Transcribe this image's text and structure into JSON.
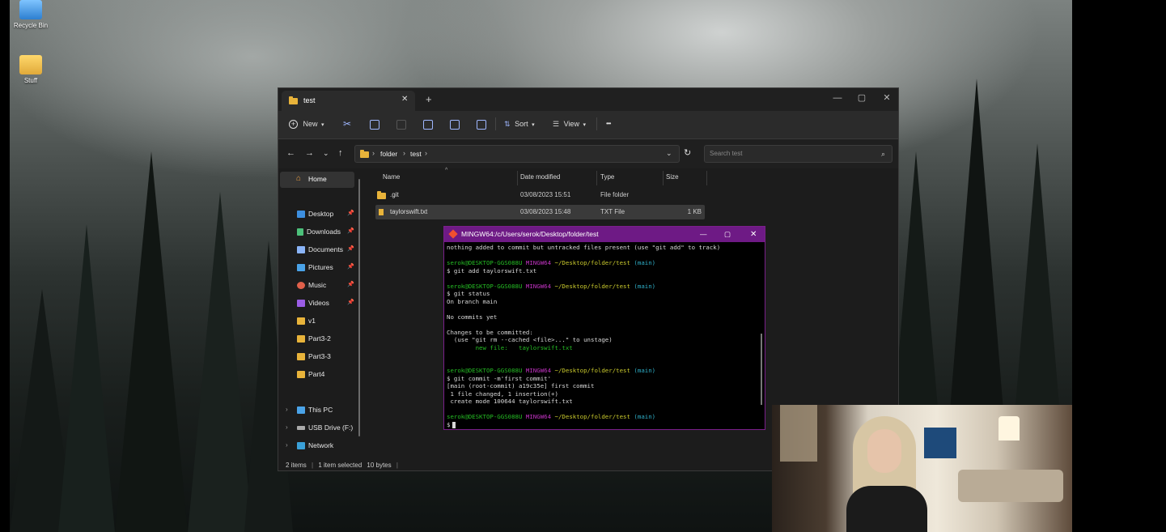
{
  "desktop": {
    "icons": [
      {
        "label": "Recycle Bin",
        "icon": "recycle-bin-icon"
      },
      {
        "label": "Stuff",
        "icon": "folder-icon"
      }
    ]
  },
  "explorer": {
    "tab_title": "test",
    "new_tab": "+",
    "window_buttons": {
      "minimize": "—",
      "maximize": "▢",
      "close": "✕"
    },
    "toolbar": {
      "new_label": "New",
      "sort_label": "Sort",
      "view_label": "View",
      "more": "•••"
    },
    "breadcrumb": [
      "folder",
      "test"
    ],
    "search_placeholder": "Search test",
    "sidebar": {
      "home": "Home",
      "pinned": [
        "Desktop",
        "Downloads",
        "Documents",
        "Pictures",
        "Music",
        "Videos"
      ],
      "folders": [
        "v1",
        "Part3-2",
        "Part3-3",
        "Part4"
      ],
      "drives": [
        "This PC",
        "USB Drive (F:)",
        "Network"
      ]
    },
    "columns": {
      "name": "Name",
      "date": "Date modified",
      "type": "Type",
      "size": "Size"
    },
    "files": [
      {
        "name": ".git",
        "date": "03/08/2023 15:51",
        "type": "File folder",
        "size": ""
      },
      {
        "name": "taylorswift.txt",
        "date": "03/08/2023 15:48",
        "type": "TXT File",
        "size": "1 KB"
      }
    ],
    "status": {
      "items": "2 items",
      "selected": "1 item selected",
      "bytes": "10 bytes"
    }
  },
  "terminal": {
    "title": "MINGW64:/c/Users/serok/Desktop/folder/test",
    "prompt_user": "serok@DESKTOP-GGS088U",
    "prompt_env": "MINGW64",
    "prompt_path": "~/Desktop/folder/test",
    "prompt_branch": "(main)",
    "lines": {
      "l0": "nothing added to commit but untracked files present (use \"git add\" to track)",
      "l1": "$ git add taylorswift.txt",
      "l2": "$ git status",
      "l3": "On branch main",
      "l4": "No commits yet",
      "l5": "Changes to be committed:",
      "l6": "  (use \"git rm --cached <file>...\" to unstage)",
      "l7": "        new file:   taylorswift.txt",
      "l8": "$ git commit -m'first commit'",
      "l9": "[main (root-commit) a19c35e] first commit",
      "l10": " 1 file changed, 1 insertion(+)",
      "l11": " create mode 100644 taylorswift.txt",
      "l12": "$"
    }
  }
}
